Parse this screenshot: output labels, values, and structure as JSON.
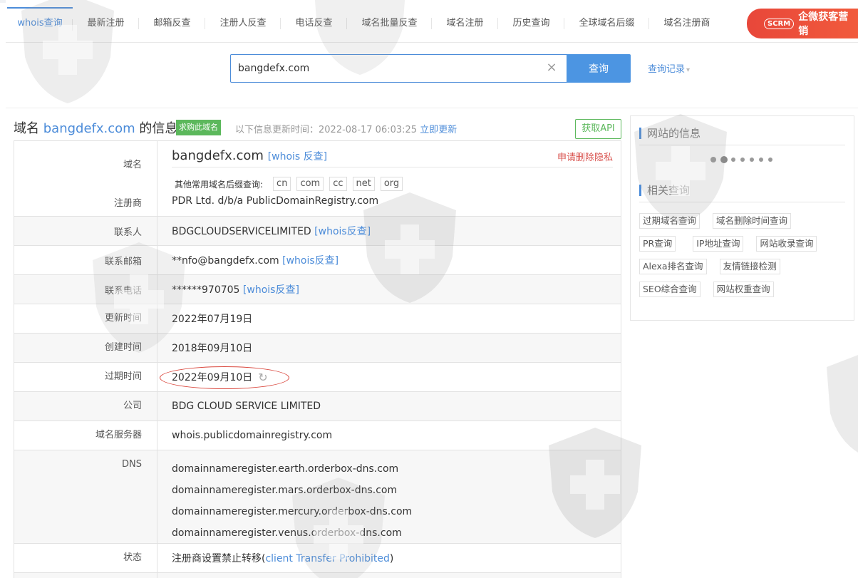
{
  "nav": {
    "tabs": [
      "whois查询",
      "最新注册",
      "邮箱反查",
      "注册人反查",
      "电话反查",
      "域名批量反查",
      "域名注册",
      "历史查询",
      "全球域名后缀",
      "域名注册商"
    ],
    "active_index": 0
  },
  "banner": {
    "logo": "SCRM",
    "text": "企微获客营销"
  },
  "search": {
    "value": "bangdefx.com",
    "clear_icon": "×",
    "button": "查询",
    "history": "查询记录",
    "history_caret": "▾"
  },
  "header": {
    "prefix": "域名 ",
    "domain": "bangdefx.com",
    "suffix": " 的信息",
    "buy_badge": "求购此域名",
    "update_label": "以下信息更新时间：2022-08-17 06:03:25 ",
    "update_link": "立即更新",
    "api_button": "获取API"
  },
  "info": {
    "domain_label": "域名",
    "domain_value": "bangdefx.com",
    "domain_whois_link": "[whois 反查]",
    "privacy_link": "申请删除隐私",
    "suffix_label": "其他常用域名后缀查询:",
    "suffixes": [
      "cn",
      "com",
      "cc",
      "net",
      "org"
    ],
    "registrar_label": "注册商",
    "registrar_value": "PDR Ltd. d/b/a PublicDomainRegistry.com",
    "contact_label": "联系人",
    "contact_value": "BDGCLOUDSERVICELIMITED",
    "contact_link": "[whois反查]",
    "email_label": "联系邮箱",
    "email_value": "**nfo@bangdefx.com",
    "email_link": "[whois反查]",
    "phone_label": "联系电话",
    "phone_value": "******970705",
    "phone_link": "[whois反查]",
    "updated_label": "更新时间",
    "updated_value": "2022年07月19日",
    "created_label": "创建时间",
    "created_value": "2018年09月10日",
    "expire_label": "过期时间",
    "expire_value": "2022年09月10日",
    "company_label": "公司",
    "company_value": "BDG CLOUD SERVICE LIMITED",
    "ns_label": "域名服务器",
    "ns_value": "whois.publicdomainregistry.com",
    "dns_label": "DNS",
    "dns_values": [
      "domainnameregister.earth.orderbox-dns.com",
      "domainnameregister.mars.orderbox-dns.com",
      "domainnameregister.mercury.orderbox-dns.com",
      "domainnameregister.venus.orderbox-dns.com"
    ],
    "status_label": "状态",
    "status_prefix": "注册商设置禁止转移(",
    "status_link": "client Transfer Prohibited",
    "status_suffix": ")"
  },
  "side": {
    "site_info_title": "网站的信息",
    "related_title": "相关查询",
    "related": [
      [
        "过期域名查询",
        "域名删除时间查询"
      ],
      [
        "PR查询",
        "IP地址查询",
        "网站收录查询"
      ],
      [
        "Alexa排名查询",
        "友情链接检测"
      ],
      [
        "SEO综合查询",
        "网站权重查询"
      ]
    ]
  },
  "colors": {
    "accent": "#4c8cd9",
    "green": "#5cb85c",
    "red": "#d9534f",
    "banner": "#e8473a"
  }
}
